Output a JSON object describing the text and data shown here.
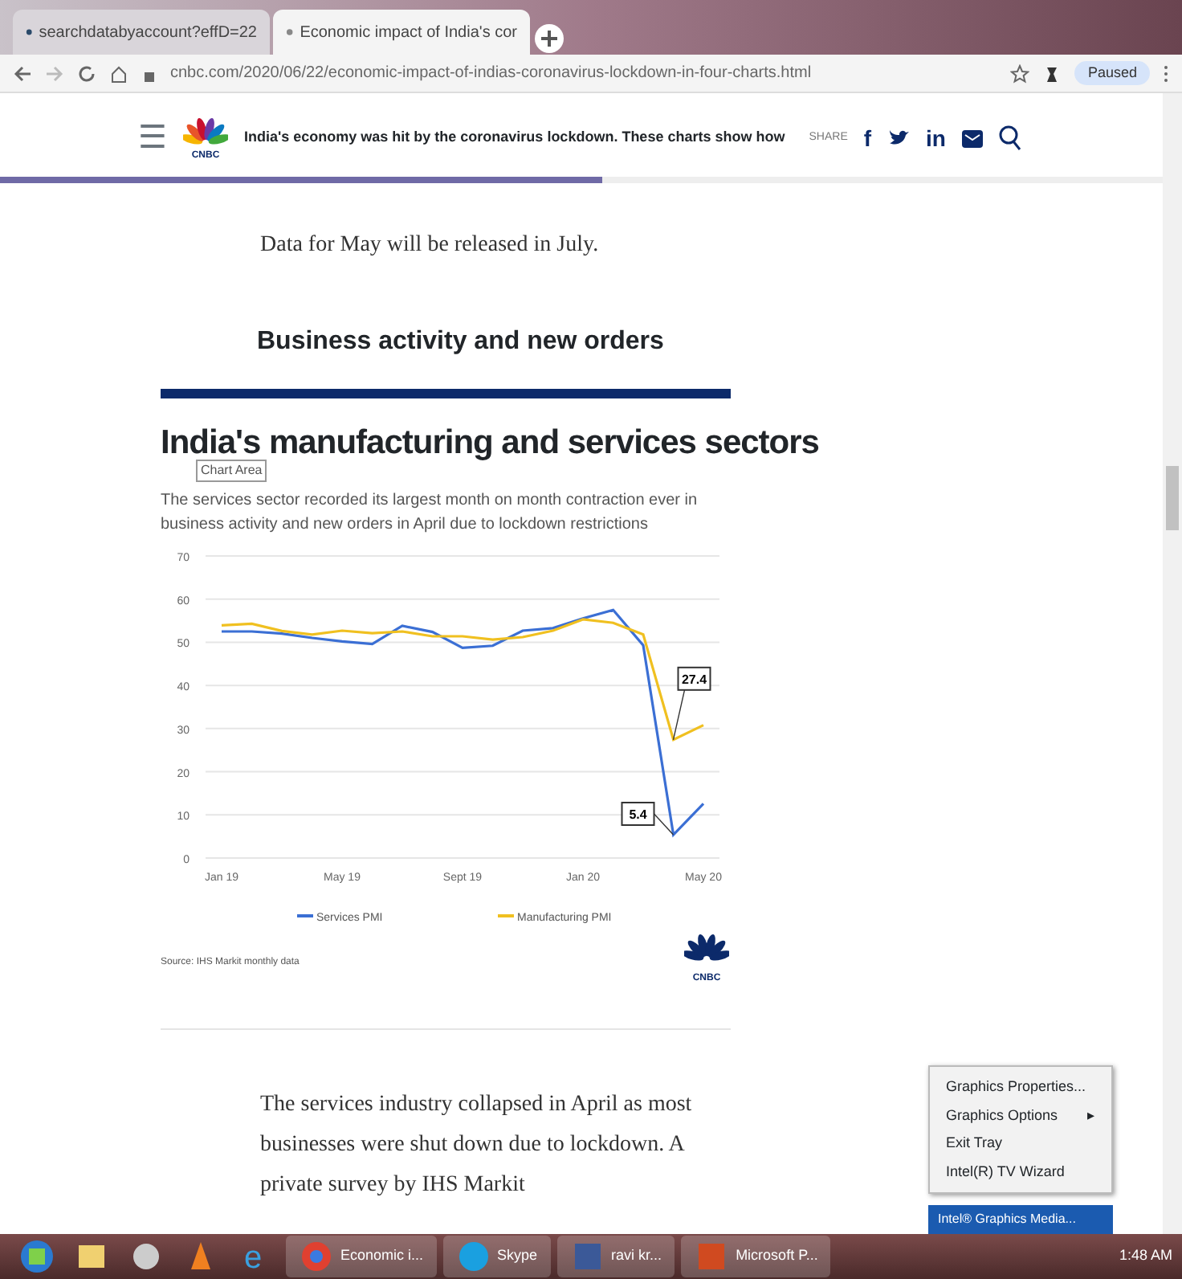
{
  "browser": {
    "tabs": [
      {
        "title": "searchdatabyaccount?effD=22",
        "selected": false
      },
      {
        "title": "Economic impact of India's cor",
        "selected": true
      }
    ],
    "address": "cnbc.com/2020/06/22/economic-impact-of-indias-coronavirus-lockdown-in-four-charts.html",
    "profile_button": "Paused"
  },
  "page_header": {
    "menu_glyph": "☰",
    "logo_text": "CNBC",
    "headline": "India's economy was hit by the coronavirus lockdown. These charts show how",
    "share_label": "SHARE",
    "share_glyphs": [
      "f",
      "in"
    ],
    "read_progress": {
      "level": 0.51
    }
  },
  "article": {
    "intro": "Data for May will be released in July.",
    "heading": "Business activity and new orders",
    "chart": {
      "title": "India's manufacturing and services sectors",
      "tooltip": "Chart Area",
      "subtitle": "The services sector recorded its largest month on month contraction ever in business activity and new orders in April due to lockdown restrictions",
      "chart_data": {
        "type": "line",
        "categories": [
          "Jan 19",
          null,
          null,
          null,
          "May 19",
          null,
          null,
          null,
          "Sept 19",
          null,
          null,
          null,
          "Jan 20",
          null,
          null,
          null,
          "May 20"
        ],
        "grid": true,
        "legend": "bottom",
        "series": [
          {
            "name": "Services PMI",
            "color": "#3b6fd4",
            "values": [
              52.5,
              52.5,
              52.0,
              51.0,
              50.2,
              49.6,
              53.8,
              52.4,
              48.7,
              49.2,
              52.7,
              53.3,
              55.5,
              57.5,
              49.3,
              5.4,
              12.6
            ]
          },
          {
            "name": "Manufacturing PMI",
            "color": "#f0c020",
            "values": [
              53.9,
              54.3,
              52.6,
              51.8,
              52.7,
              52.1,
              52.5,
              51.4,
              51.4,
              50.6,
              51.2,
              52.7,
              55.3,
              54.5,
              51.8,
              27.4,
              30.8
            ]
          }
        ],
        "ylim": [
          0,
          70
        ],
        "yticks": [
          0,
          10,
          20,
          30,
          40,
          50,
          60,
          70
        ],
        "annotations": [
          "27.4",
          "5.4"
        ]
      },
      "source": "Source: IHS Markit monthly data",
      "logo_text": "CNBC"
    },
    "after": "The services industry collapsed in April as most businesses were shut down due to lockdown. A private survey by IHS Markit"
  },
  "context_menu": {
    "items": [
      {
        "label": "Graphics Properties...",
        "kind": "item"
      },
      {
        "label": "Graphics Options",
        "kind": "submenu",
        "arrow": "▸"
      },
      {
        "label": "Exit Tray",
        "kind": "item"
      },
      {
        "label": "Intel(R) TV Wizard",
        "kind": "item"
      }
    ],
    "tray_title": "Intel® Graphics Media..."
  },
  "taskbar": {
    "apps": [
      {
        "kind": "start"
      },
      {
        "kind": "folder"
      },
      {
        "kind": "media"
      },
      {
        "kind": "cone"
      },
      {
        "kind": "e"
      },
      {
        "kind": "browser",
        "label": "Economic i..."
      },
      {
        "kind": "s",
        "label": "Skype"
      },
      {
        "kind": "f",
        "label": "ravi kr..."
      },
      {
        "kind": "slides",
        "label": "Microsoft P..."
      }
    ],
    "clock": "1:48 AM"
  }
}
